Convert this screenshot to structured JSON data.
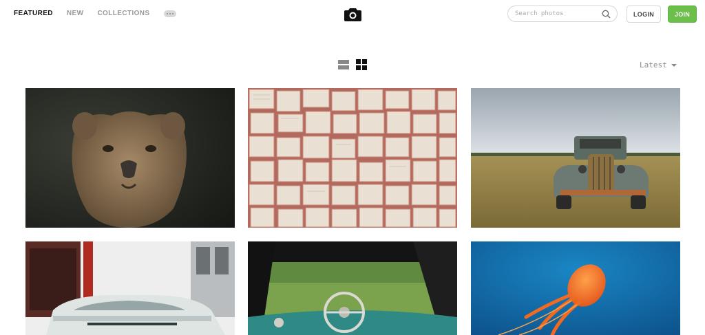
{
  "nav": {
    "items": [
      {
        "label": "FEATURED",
        "active": true
      },
      {
        "label": "NEW",
        "active": false
      },
      {
        "label": "COLLECTIONS",
        "active": false
      }
    ],
    "more_icon": "ellipsis-icon"
  },
  "logo": {
    "icon": "camera-icon"
  },
  "search": {
    "placeholder": "Search photos",
    "icon": "search-icon"
  },
  "auth": {
    "login_label": "LOGIN",
    "join_label": "JOIN"
  },
  "toolbar": {
    "view_options": [
      "list-view-icon",
      "grid-view-icon"
    ],
    "selected_view": "grid",
    "sort_label": "Latest"
  },
  "photos": [
    {
      "subject": "lioness"
    },
    {
      "subject": "wall of book pages"
    },
    {
      "subject": "rusty old truck in field"
    },
    {
      "subject": "vintage car on city street"
    },
    {
      "subject": "car interior with steering wheel"
    },
    {
      "subject": "orange jellyfish"
    }
  ],
  "colors": {
    "join": "#6cbf4a",
    "active_nav": "#111111",
    "muted": "#999999"
  }
}
